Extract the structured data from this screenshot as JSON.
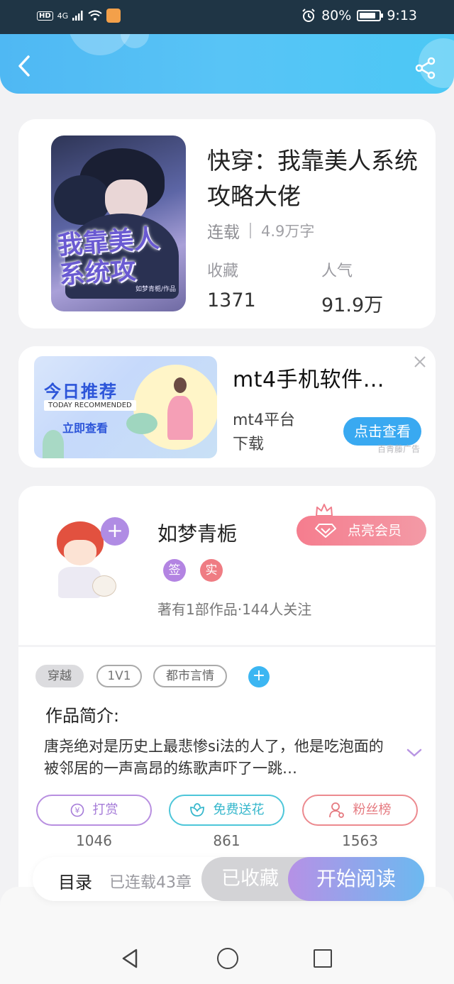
{
  "status_bar": {
    "hd": "HD",
    "network": "4G",
    "battery_percent": "80%",
    "time": "9:13"
  },
  "header": {
    "back_icon": "chevron-left-icon",
    "share_icon": "share-icon"
  },
  "book": {
    "title": "快穿：我靠美人系统攻略大佬",
    "cover_title": "我靠美人系统攻",
    "cover_author": "如梦青栀/作品",
    "status": "连载",
    "word_count": "4.9万字",
    "favorites_label": "收藏",
    "favorites_value": "1371",
    "popularity_label": "人气",
    "popularity_value": "91.9万"
  },
  "ad": {
    "image_headline": "今日推荐",
    "image_ribbon": "TODAY RECOMMENDED",
    "image_cta": "立即查看",
    "title": "mt4手机软件…",
    "description": "mt4平台下载",
    "button": "点击查看",
    "source": "百青藤广告"
  },
  "author": {
    "name": "如梦青栀",
    "vip_button": "点亮会员",
    "badge_sign": "签",
    "badge_real": "实",
    "meta": "著有1部作品·144人关注"
  },
  "tags": [
    "穿越",
    "1V1",
    "都市言情"
  ],
  "intro": {
    "title": "作品简介:",
    "text": "唐尧绝对是历史上最悲惨si法的人了，他是吃泡面的被邻居的一声高昂的练歌声吓了一跳…"
  },
  "actions": [
    {
      "label": "打赏",
      "count": "1046",
      "icon": "coin-icon"
    },
    {
      "label": "免费送花",
      "count": "861",
      "icon": "flower-icon"
    },
    {
      "label": "粉丝榜",
      "count": "1563",
      "icon": "user-rank-icon"
    }
  ],
  "bottom_bar": {
    "toc": "目录",
    "toc_sub": "已连载43章",
    "collected": "已收藏",
    "start_reading": "开始阅读"
  },
  "colors": {
    "header_blue": "#52bff5",
    "accent_purple": "#b08ce4",
    "accent_pink": "#f57d8e",
    "accent_cyan": "#3cb6f2"
  }
}
